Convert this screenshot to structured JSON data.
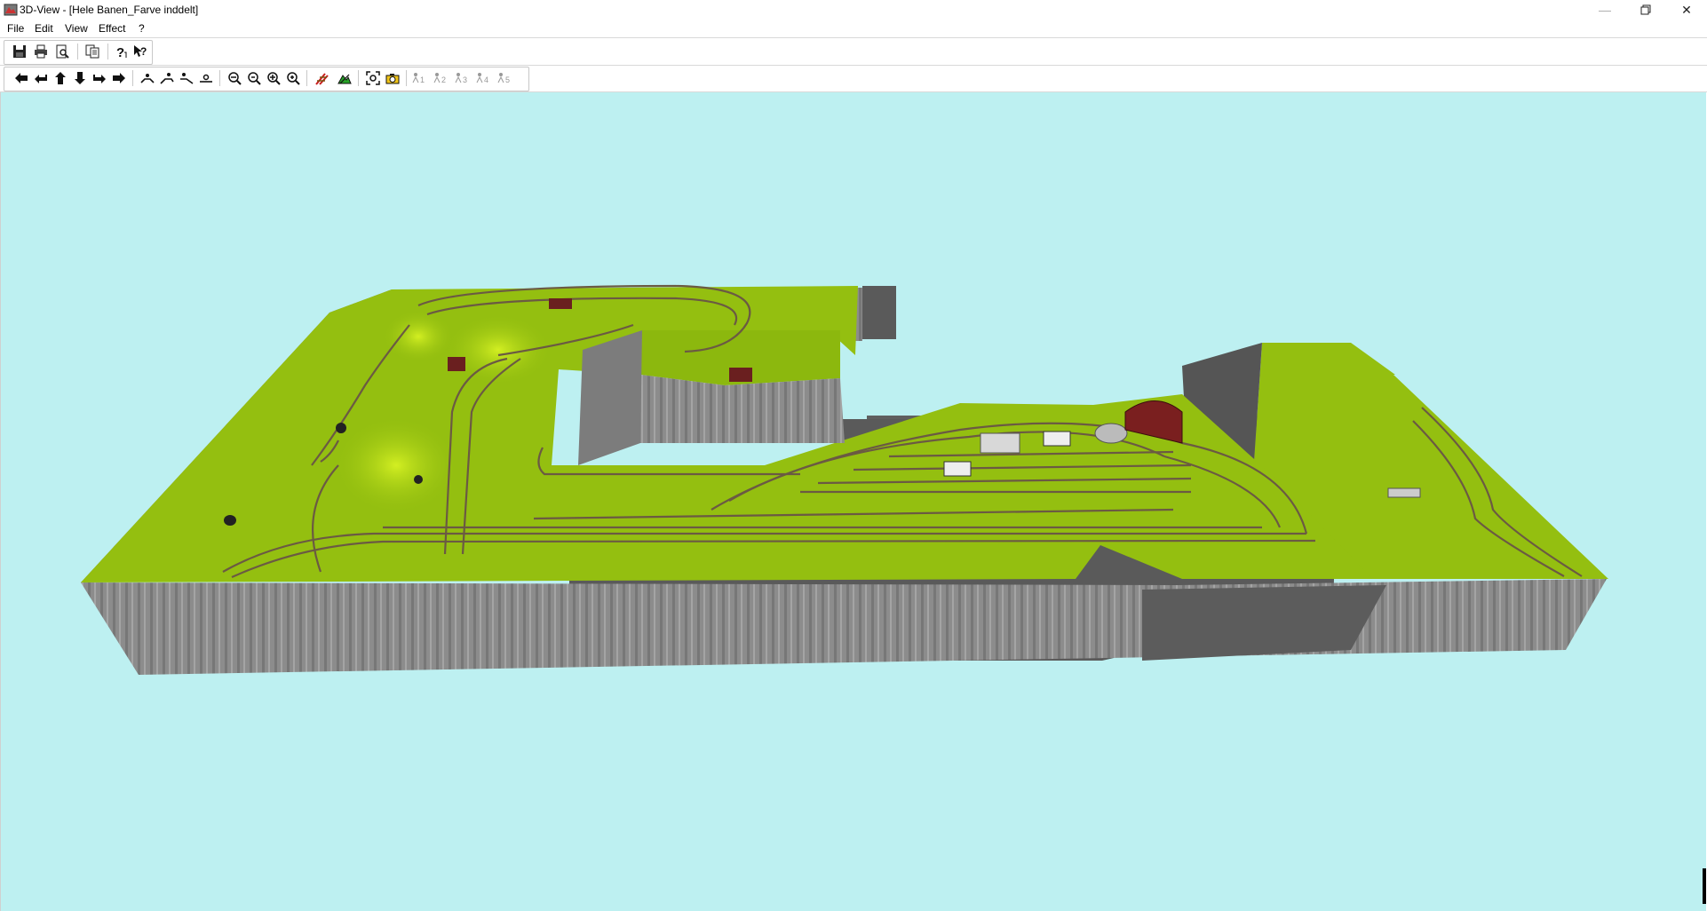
{
  "window": {
    "title": "3D-View - [Hele Banen_Farve inddelt]",
    "controls": [
      "minimize-icon",
      "restore-icon",
      "close-icon"
    ]
  },
  "menu": [
    "File",
    "Edit",
    "View",
    "Effect",
    "?"
  ],
  "toolbar1": [
    "save-icon",
    "print-icon",
    "print-preview-icon",
    "copy-icon",
    "help-icon",
    "context-help-icon"
  ],
  "toolbar2": [
    "arrow-left-icon",
    "arrow-turn-left-icon",
    "arrow-up-icon",
    "arrow-down-icon",
    "arrow-turn-right-icon",
    "arrow-right-icon",
    "orbit-1-icon",
    "orbit-2-icon",
    "orbit-3-icon",
    "orbit-4-icon",
    "zoom-out-icon",
    "zoom-out-2-icon",
    "zoom-in-icon",
    "zoom-in-2-icon",
    "track-icon",
    "terrain-icon",
    "zoom-fit-icon",
    "camera-icon",
    "cam-1-icon",
    "cam-2-icon",
    "cam-3-icon",
    "cam-4-icon",
    "cam-5-icon"
  ],
  "camera_positions": [
    "1",
    "2",
    "3",
    "4",
    "5"
  ],
  "colors": {
    "sky": "#bdf0f1",
    "grass": "#94bf10",
    "grass_dark": "#7ca40a",
    "cliff": "#8a8a8a",
    "cliff_dark": "#5e5e5e",
    "track": "#6b5a43"
  }
}
